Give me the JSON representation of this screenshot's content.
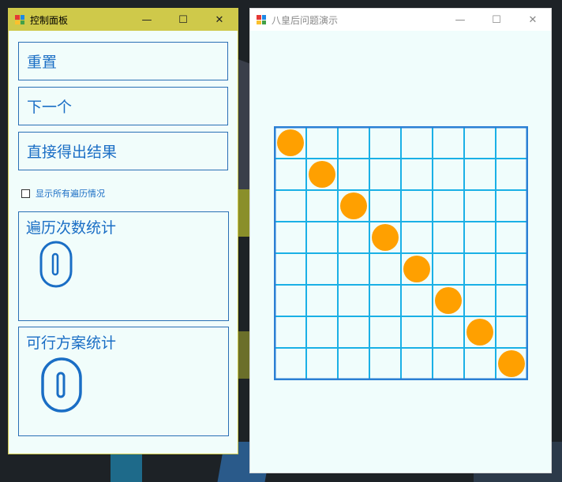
{
  "control_window": {
    "title": "控制面板",
    "minimize_glyph": "—",
    "maximize_glyph": "☐",
    "close_glyph": "✕"
  },
  "controls": {
    "reset_label": "重置",
    "next_label": "下一个",
    "direct_result_label": "直接得出结果",
    "show_all_label": "显示所有遍历情况",
    "show_all_checked": false
  },
  "stats": {
    "traversal_title": "遍历次数统计",
    "traversal_count": "0",
    "solution_title": "可行方案统计",
    "solution_count": "0"
  },
  "board_window": {
    "title": "八皇后问题演示",
    "minimize_glyph": "—",
    "maximize_glyph": "☐",
    "close_glyph": "✕"
  },
  "board": {
    "size": 8,
    "queen_columns": [
      0,
      1,
      2,
      3,
      4,
      5,
      6,
      7
    ],
    "grid_color": "#1ab0e6",
    "border_color": "#2a7fd4",
    "queen_color": "#ffa000"
  },
  "colors": {
    "title_bar_active": "#cfc94a",
    "text_blue": "#1a6ec5"
  },
  "icons": {
    "app": "app-icon"
  }
}
